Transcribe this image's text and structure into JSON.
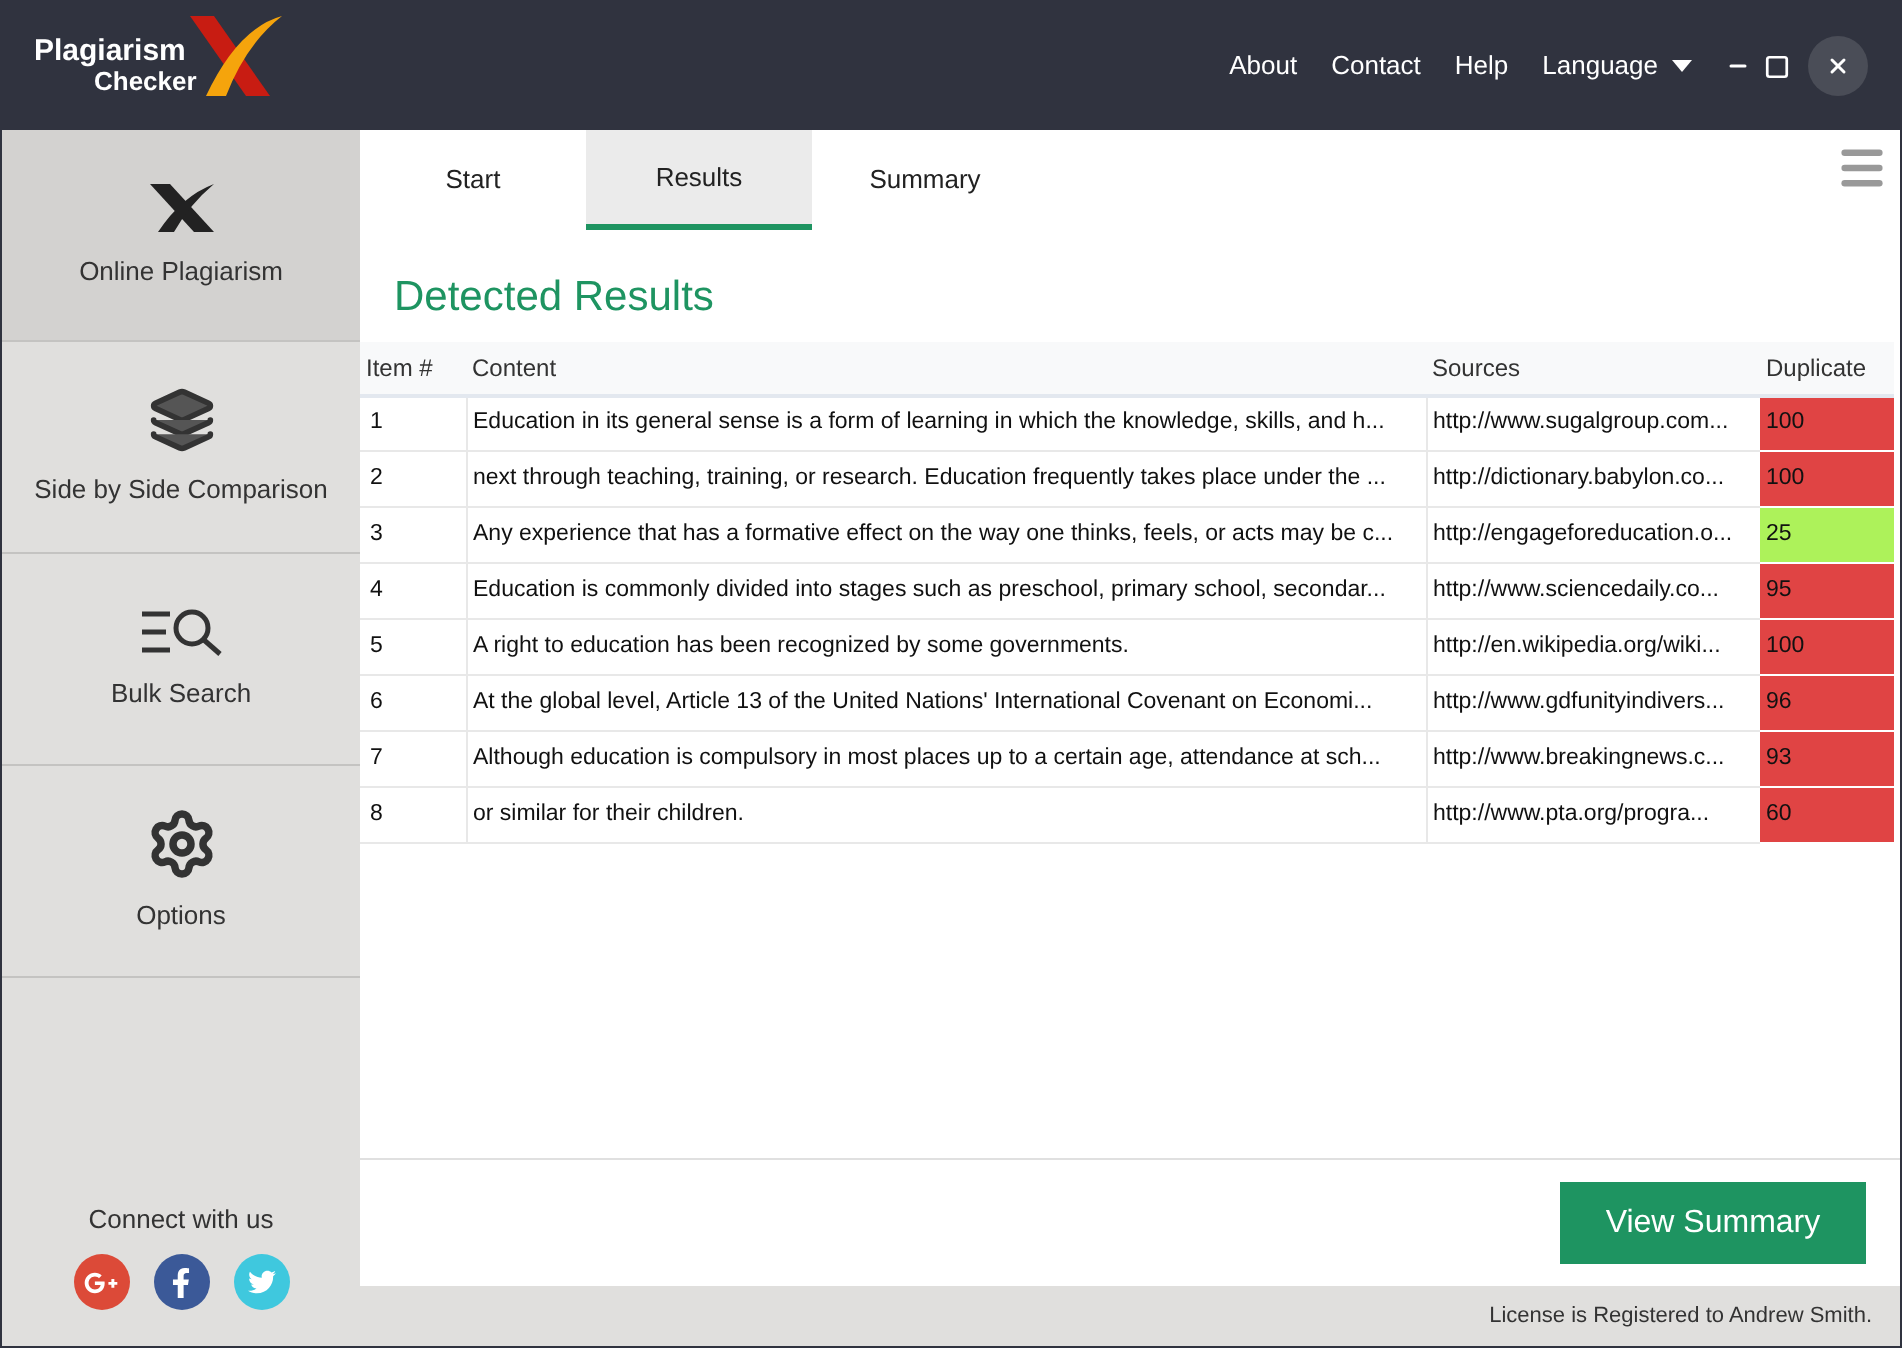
{
  "logo": {
    "line_1": "Plagiarism",
    "line_2": "Checker"
  },
  "top_menu": [
    "About",
    "Contact",
    "Help",
    "Language"
  ],
  "sidebar": {
    "items": [
      {
        "label": "Online Plagiarism",
        "kind": "logo",
        "selected": true
      },
      {
        "label": "Side by Side Comparison",
        "kind": "layers",
        "selected": false
      },
      {
        "label": "Bulk Search",
        "kind": "bulk",
        "selected": false
      },
      {
        "label": "Options",
        "kind": "gear",
        "selected": false
      }
    ],
    "connect_label": "Connect with us"
  },
  "tabs": [
    {
      "label": "Start",
      "selected": false
    },
    {
      "label": "Results",
      "selected": true
    },
    {
      "label": "Summary",
      "selected": false
    }
  ],
  "heading": "Detected Results",
  "table": {
    "columns": [
      "Item #",
      "Content",
      "Sources",
      "Duplicate"
    ],
    "rows": [
      {
        "item": "1",
        "content": "Education in its general sense is a form of learning in which the knowledge, skills, and h...",
        "source": "http://www.sugalgroup.com...",
        "duplicate": "100",
        "color": "#e04444"
      },
      {
        "item": "2",
        "content": "next through teaching, training, or research. Education frequently takes place under the ...",
        "source": "http://dictionary.babylon.co...",
        "duplicate": "100",
        "color": "#e04444"
      },
      {
        "item": "3",
        "content": "Any experience that has a formative effect on the way one thinks, feels, or acts may be c...",
        "source": "http://engageforeducation.o...",
        "duplicate": "25",
        "color": "#adf25a"
      },
      {
        "item": "4",
        "content": "Education is commonly divided into stages such as preschool, primary school, secondar...",
        "source": "http://www.sciencedaily.co...",
        "duplicate": "95",
        "color": "#e04444"
      },
      {
        "item": "5",
        "content": "A right to education has been recognized by some governments.",
        "source": "http://en.wikipedia.org/wiki...",
        "duplicate": "100",
        "color": "#e04444"
      },
      {
        "item": "6",
        "content": "At the global level, Article 13 of the United Nations' International Covenant on Economi...",
        "source": "http://www.gdfunityindivers...",
        "duplicate": "96",
        "color": "#e04444"
      },
      {
        "item": "7",
        "content": "Although education is compulsory in most places up to a certain age, attendance at sch...",
        "source": "http://www.breakingnews.c...",
        "duplicate": "93",
        "color": "#e04444"
      },
      {
        "item": "8",
        "content": "or similar for their children.",
        "source": "http://www.pta.org/progra...",
        "duplicate": "60",
        "color": "#e04444"
      }
    ]
  },
  "button": "View Summary",
  "status_bar": "License is Registered to Andrew Smith."
}
